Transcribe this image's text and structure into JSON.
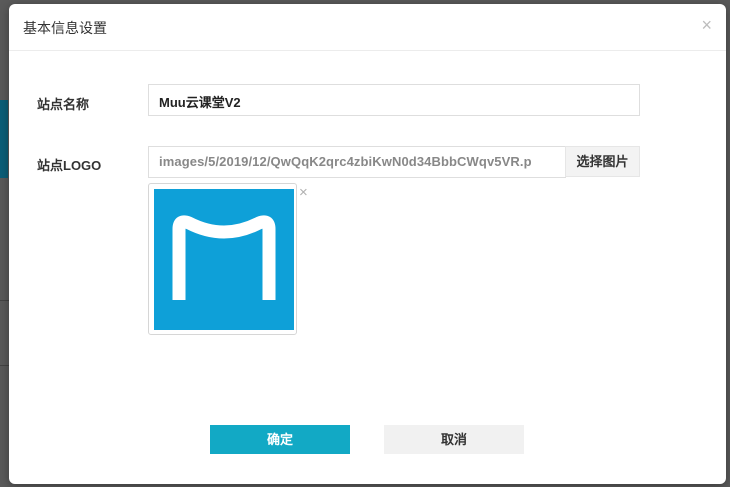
{
  "dialog": {
    "title": "基本信息设置",
    "close_glyph": "×"
  },
  "form": {
    "site_name": {
      "label": "站点名称",
      "value": "Muu云课堂V2"
    },
    "site_logo": {
      "label": "站点LOGO",
      "path_value": "images/5/2019/12/QwQqK2qrc4zbiKwN0d34BbbCWqv5VR.p",
      "choose_button": "选择图片",
      "remove_glyph": "×",
      "logo_color": "#0ea0d8"
    }
  },
  "buttons": {
    "ok": "确定",
    "cancel": "取消"
  },
  "colors": {
    "primary": "#12a9c5",
    "logo_blue": "#0ea0d8"
  }
}
